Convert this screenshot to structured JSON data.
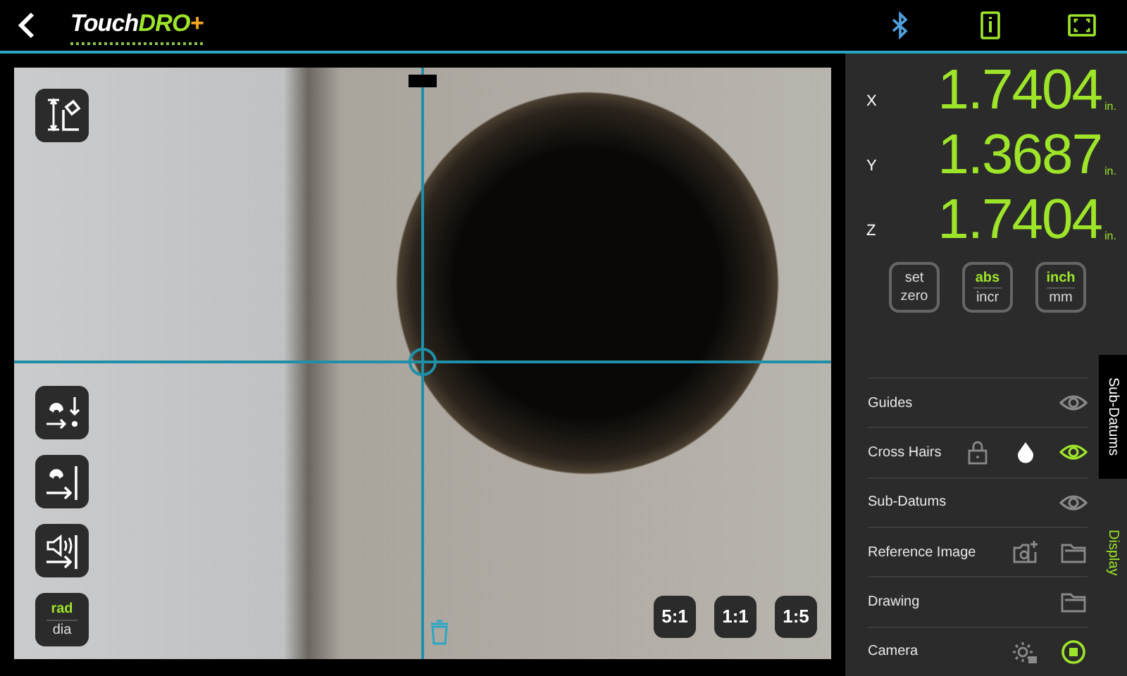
{
  "header": {
    "logo": [
      {
        "text": "Touch",
        "kind": "plain"
      },
      {
        "text": "DRO",
        "kind": "accent"
      },
      {
        "text": "+",
        "kind": "plus"
      }
    ]
  },
  "camera": {
    "tools": [
      {
        "kind": "measure"
      },
      {
        "kind": "magnet-down"
      },
      {
        "kind": "magnet-edge"
      },
      {
        "kind": "sound-edge"
      },
      {
        "kind": "toggle",
        "options": [
          {
            "label": "rad",
            "selected": true
          },
          {
            "label": "dia",
            "selected": false
          }
        ]
      }
    ],
    "zoom_buttons": [
      "5:1",
      "1:1",
      "1:5"
    ]
  },
  "dro": {
    "axes": [
      {
        "axis": "X",
        "value": "1.7404",
        "unit": "in."
      },
      {
        "axis": "Y",
        "value": "1.3687",
        "unit": "in."
      },
      {
        "axis": "Z",
        "value": "1.7404",
        "unit": "in."
      }
    ],
    "buttons": [
      {
        "kind": "action",
        "options": [
          {
            "label": "set"
          },
          {
            "label": "zero"
          }
        ]
      },
      {
        "kind": "toggle",
        "options": [
          {
            "label": "abs",
            "selected": true
          },
          {
            "label": "incr",
            "selected": false
          }
        ]
      },
      {
        "kind": "toggle",
        "options": [
          {
            "label": "inch",
            "selected": true
          },
          {
            "label": "mm",
            "selected": false
          }
        ]
      }
    ]
  },
  "display_list": [
    {
      "label": "Guides",
      "icons": [
        {
          "kind": "eye",
          "on": false
        }
      ]
    },
    {
      "label": "Cross Hairs",
      "icons": [
        {
          "kind": "lock",
          "on": false
        },
        {
          "kind": "drop",
          "on": true
        },
        {
          "kind": "eye",
          "on": true
        }
      ]
    },
    {
      "label": "Sub-Datums",
      "icons": [
        {
          "kind": "eye",
          "on": false
        }
      ]
    },
    {
      "label": "Reference Image",
      "icons": [
        {
          "kind": "camera-add",
          "on": false
        },
        {
          "kind": "folder",
          "on": false
        }
      ]
    },
    {
      "label": "Drawing",
      "icons": [
        {
          "kind": "folder",
          "on": false
        }
      ]
    },
    {
      "label": "Camera",
      "icons": [
        {
          "kind": "gear",
          "on": false
        },
        {
          "kind": "stop",
          "on": true
        }
      ]
    }
  ],
  "side_tabs": [
    {
      "label": "Sub-Datums",
      "selected": false
    },
    {
      "label": "Display",
      "selected": true
    }
  ]
}
